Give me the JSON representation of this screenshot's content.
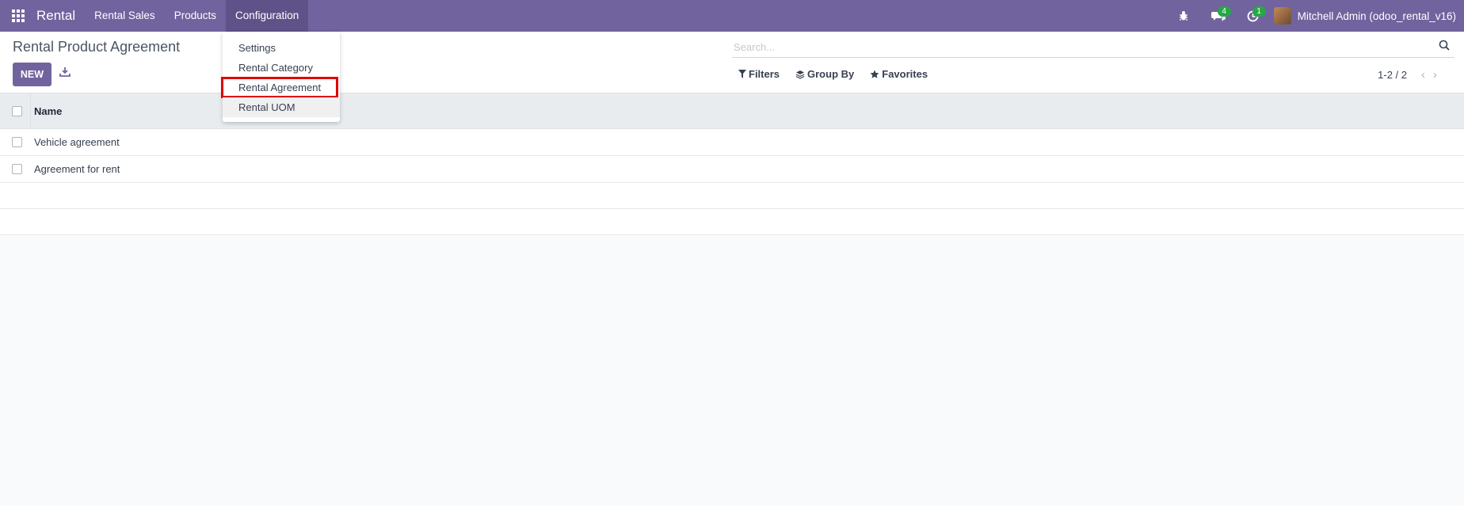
{
  "navbar": {
    "brand": "Rental",
    "menus": [
      "Rental Sales",
      "Products",
      "Configuration"
    ],
    "chat_badge": "4",
    "activity_badge": "1",
    "user_name": "Mitchell Admin (odoo_rental_v16)"
  },
  "control_panel": {
    "title": "Rental Product Agreement",
    "new_label": "NEW",
    "search_placeholder": "Search...",
    "filters_label": "Filters",
    "group_by_label": "Group By",
    "favorites_label": "Favorites",
    "pager_value": "1-2 / 2"
  },
  "dropdown": {
    "items": [
      "Settings",
      "Rental Category",
      "Rental Agreement",
      "Rental UOM"
    ]
  },
  "list": {
    "column_name": "Name",
    "rows": [
      "Vehicle agreement",
      "Agreement for rent"
    ]
  },
  "colors": {
    "brand": "#71639e",
    "highlight": "#e00000",
    "badge": "#28a745"
  }
}
